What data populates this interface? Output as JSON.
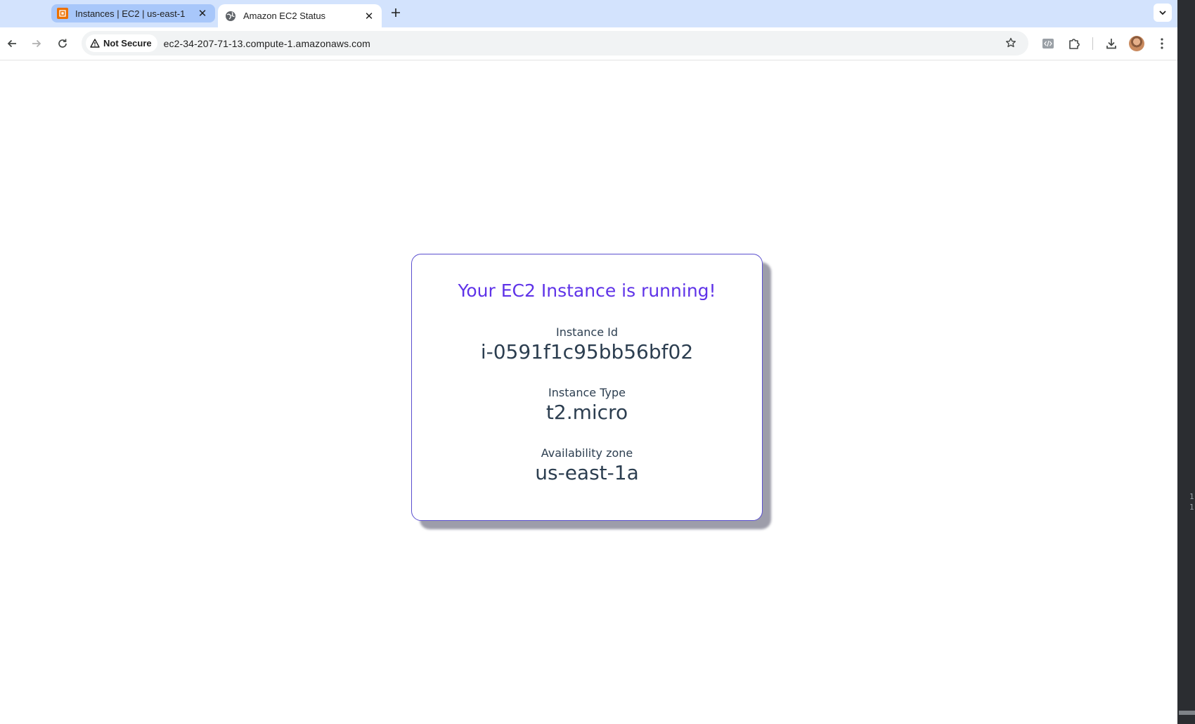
{
  "browser": {
    "tabs": [
      {
        "title": "Instances | EC2 | us-east-1",
        "favicon": "aws-ec2-icon",
        "active": false
      },
      {
        "title": "Amazon EC2 Status",
        "favicon": "globe-icon",
        "active": true
      }
    ],
    "address_bar": {
      "security_label": "Not Secure",
      "url": "ec2-34-207-71-13.compute-1.amazonaws.com"
    }
  },
  "page": {
    "title": "Your EC2 Instance is running!",
    "fields": [
      {
        "label": "Instance Id",
        "value": "i-0591f1c95bb56bf02"
      },
      {
        "label": "Instance Type",
        "value": "t2.micro"
      },
      {
        "label": "Availability zone",
        "value": "us-east-1a"
      }
    ]
  },
  "side_panel": {
    "line_numbers": [
      "1",
      "1"
    ]
  },
  "colors": {
    "title": "#5f33e8",
    "card_border": "#5a4fcf",
    "text": "#2c3e50",
    "tabstrip": "#d3e3fd"
  }
}
